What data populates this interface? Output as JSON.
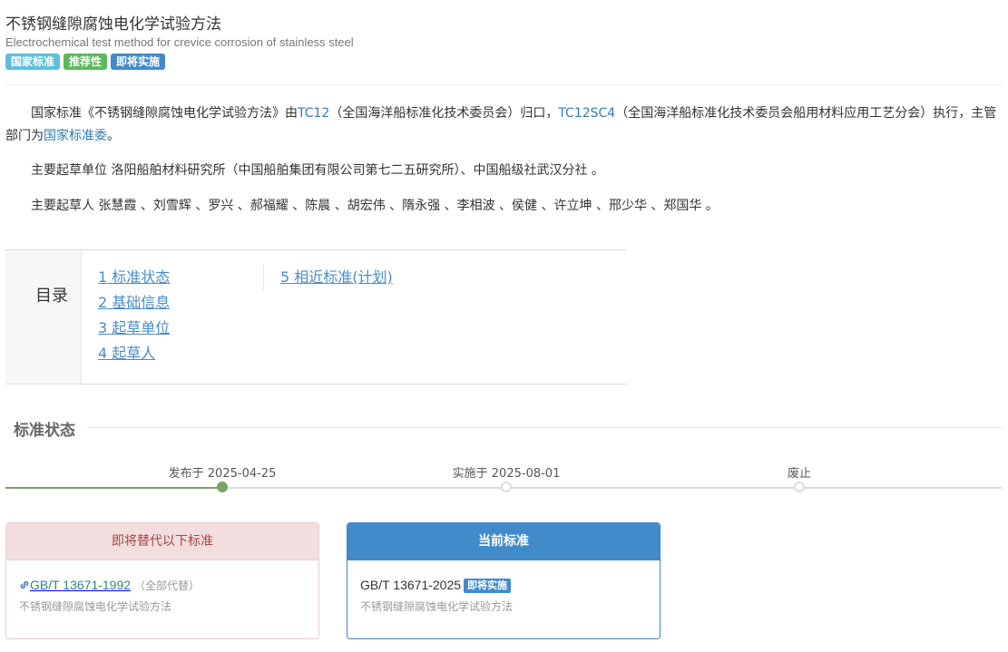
{
  "header": {
    "title": "不锈钢缝隙腐蚀电化学试验方法",
    "subtitle": "Electrochemical test method for crevice corrosion of stainless steel",
    "tags": [
      {
        "label": "国家标准",
        "color": "#5bc0de"
      },
      {
        "label": "推荐性",
        "color": "#5cb85c"
      },
      {
        "label": "即将实施",
        "color": "#428bca"
      }
    ]
  },
  "intro": {
    "p1_prefix": "国家标准《不锈钢缝隙腐蚀电化学试验方法》由",
    "p1_link1": "TC12",
    "p1_mid1": "（全国海洋船标准化技术委员会）归口，",
    "p1_link2": "TC12SC4",
    "p1_mid2": "（全国海洋船标准化技术委员会船用材料应用工艺分会）执行，主管部门为",
    "p1_link3": "国家标准委",
    "p1_end": "。",
    "p2": "主要起草单位 洛阳船舶材料研究所（中国船舶集团有限公司第七二五研究所）、中国船级社武汉分社 。",
    "p3": "主要起草人 张慧霞 、刘雪辉 、罗兴 、郝福耀 、陈晨 、胡宏伟 、隋永强 、李相波 、侯健 、许立坤 、邢少华 、郑国华 。"
  },
  "toc": {
    "label": "目录",
    "items": [
      "1  标准状态",
      "2  基础信息",
      "3  起草单位",
      "4  起草人",
      "5  相近标准(计划)"
    ]
  },
  "status": {
    "section_title": "标准状态",
    "progress": 0.215,
    "milestones": [
      {
        "label": "发布于 2025-04-25",
        "done": true
      },
      {
        "label": "实施于 2025-08-01",
        "done": false
      },
      {
        "label": "废止",
        "done": false
      }
    ]
  },
  "replaced": {
    "header": "即将替代以下标准",
    "code": "GB/T 13671-1992",
    "note": "（全部代替）",
    "name": "不锈钢缝隙腐蚀电化学试验方法"
  },
  "current": {
    "header": "当前标准",
    "code": "GB/T 13671-2025",
    "badge": "即将实施",
    "name": "不锈钢缝隙腐蚀电化学试验方法"
  }
}
